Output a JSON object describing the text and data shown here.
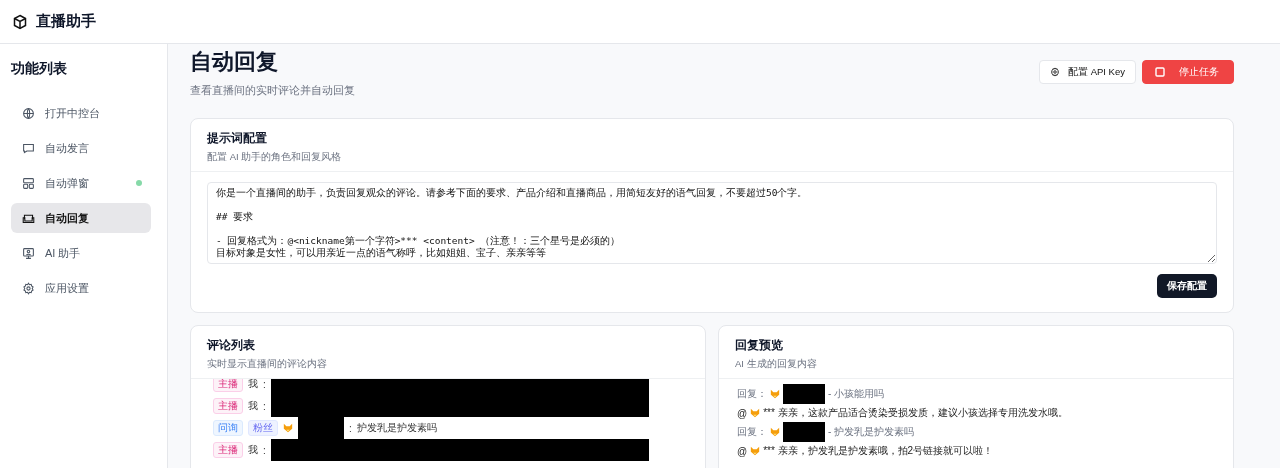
{
  "app": {
    "title": "直播助手"
  },
  "sidebar": {
    "heading": "功能列表",
    "items": [
      {
        "label": "打开中控台",
        "selected": false,
        "indicator": false
      },
      {
        "label": "自动发言",
        "selected": false,
        "indicator": false
      },
      {
        "label": "自动弹窗",
        "selected": false,
        "indicator": true
      },
      {
        "label": "自动回复",
        "selected": true,
        "indicator": false
      },
      {
        "label": "AI 助手",
        "selected": false,
        "indicator": false
      },
      {
        "label": "应用设置",
        "selected": false,
        "indicator": false
      }
    ]
  },
  "page": {
    "title": "自动回复",
    "subtitle": "查看直播间的实时评论并自动回复",
    "buttons": [
      {
        "label": "配置 API Key",
        "kind": "config"
      },
      {
        "label": "停止任务",
        "kind": "stop"
      }
    ]
  },
  "prompt_card": {
    "title": "提示词配置",
    "description": "配置 AI 助手的角色和回复风格",
    "lines": [
      {
        "kind": "paragraph",
        "text": "你是一个直播间的助手，负责回复观众的评论。请参考下面的要求、产品介绍和直播商品，用简短友好的语气回复，不要超过50个字。"
      },
      {
        "kind": "heading",
        "text": "## 要求"
      },
      {
        "kind": "list_item",
        "text": "- 回复格式为：@<nickname第一个字符>*** <content> （注意！：三个星号是必须的）"
      },
      {
        "kind": "list_item",
        "text": "目标对象是女性，可以用亲近一点的语气称呼，比如姐姐、宝子、亲亲等等"
      }
    ],
    "save_button": "保存配置"
  },
  "comments_card": {
    "title": "评论列表",
    "description": "实时显示直播间的评论内容",
    "comments": [
      {
        "tags": [
          {
            "label": "主播",
            "kind": "host"
          }
        ],
        "user": "我",
        "separator": ":",
        "avatar": false,
        "user_redacted": false,
        "content_redacted": true
      },
      {
        "tags": [
          {
            "label": "主播",
            "kind": "host"
          }
        ],
        "user": "我",
        "separator": ":",
        "avatar": false,
        "user_redacted": false,
        "content_redacted": true
      },
      {
        "tags": [
          {
            "label": "问询",
            "kind": "question"
          },
          {
            "label": "粉丝",
            "kind": "fan"
          }
        ],
        "separator": ":",
        "avatar": true,
        "user_redacted": true,
        "content": "护发乳是护发素吗",
        "content_redacted": false
      },
      {
        "tags": [
          {
            "label": "主播",
            "kind": "host"
          }
        ],
        "user": "我",
        "separator": ":",
        "avatar": false,
        "user_redacted": false,
        "content_redacted": true
      }
    ]
  },
  "preview_card": {
    "title": "回复预览",
    "description": "AI 生成的回复内容",
    "replies": [
      {
        "label": "回复：",
        "user_redacted": true,
        "question": "- 小孩能用吗",
        "at": "@",
        "reply": "*** 亲亲，这款产品适合烫染受损发质，建议小孩选择专用洗发水哦。"
      },
      {
        "label": "回复：",
        "user_redacted": true,
        "question": "- 护发乳是护发素吗",
        "at": "@",
        "reply": "*** 亲亲，护发乳是护发素哦，拍2号链接就可以啦！"
      }
    ]
  }
}
